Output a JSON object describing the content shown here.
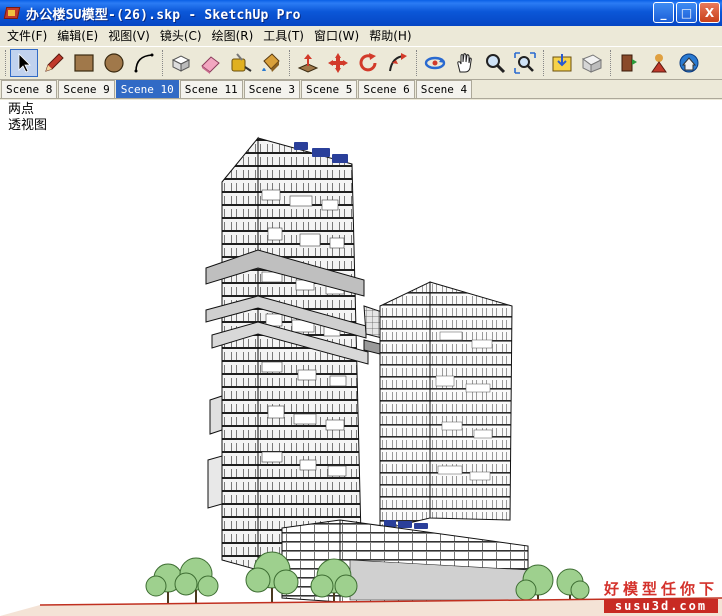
{
  "window": {
    "title": "办公楼SU模型-(26).skp - SketchUp Pro",
    "minimize_label": "_",
    "maximize_label": "□",
    "close_label": "X"
  },
  "menu": [
    {
      "id": "file",
      "label": "文件(F)"
    },
    {
      "id": "edit",
      "label": "编辑(E)"
    },
    {
      "id": "view",
      "label": "视图(V)"
    },
    {
      "id": "camera",
      "label": "镜头(C)"
    },
    {
      "id": "draw",
      "label": "绘图(R)"
    },
    {
      "id": "tools",
      "label": "工具(T)"
    },
    {
      "id": "window",
      "label": "窗口(W)"
    },
    {
      "id": "help",
      "label": "帮助(H)"
    }
  ],
  "toolbar": {
    "tools": [
      {
        "id": "select",
        "icon": "arrow-cursor-icon",
        "active": true
      },
      {
        "id": "line",
        "icon": "pencil-icon"
      },
      {
        "id": "rectangle",
        "icon": "rectangle-icon"
      },
      {
        "id": "circle",
        "icon": "circle-icon"
      },
      {
        "id": "arc",
        "icon": "arc-icon"
      },
      {
        "id": "make-component",
        "icon": "component-icon"
      },
      {
        "id": "eraser",
        "icon": "eraser-icon"
      },
      {
        "id": "tape-measure",
        "icon": "tape-measure-icon"
      },
      {
        "id": "paint-bucket",
        "icon": "paint-bucket-icon"
      },
      {
        "id": "push-pull",
        "icon": "push-pull-icon"
      },
      {
        "id": "move",
        "icon": "move-icon"
      },
      {
        "id": "rotate",
        "icon": "rotate-icon"
      },
      {
        "id": "follow-me",
        "icon": "follow-me-icon"
      },
      {
        "id": "orbit",
        "icon": "orbit-icon"
      },
      {
        "id": "pan",
        "icon": "pan-hand-icon"
      },
      {
        "id": "zoom",
        "icon": "zoom-icon"
      },
      {
        "id": "zoom-extents",
        "icon": "zoom-extents-icon"
      },
      {
        "id": "get-models",
        "icon": "get-models-icon"
      },
      {
        "id": "share-model",
        "icon": "share-model-icon"
      },
      {
        "id": "share-component",
        "icon": "share-component-icon"
      },
      {
        "id": "extension",
        "icon": "extension-icon"
      },
      {
        "id": "geo-location",
        "icon": "geo-location-icon"
      }
    ]
  },
  "scenes": [
    {
      "label": "Scene 8",
      "active": false
    },
    {
      "label": "Scene 9",
      "active": false
    },
    {
      "label": "Scene 10",
      "active": true
    },
    {
      "label": "Scene 11",
      "active": false
    },
    {
      "label": "Scene 3",
      "active": false
    },
    {
      "label": "Scene 5",
      "active": false
    },
    {
      "label": "Scene 6",
      "active": false
    },
    {
      "label": "Scene 4",
      "active": false
    }
  ],
  "viewport": {
    "label_line1": "两点",
    "label_line2": "透视图"
  },
  "watermark": {
    "main": "好模型任你下",
    "sub": "susu3d.com"
  },
  "colors": {
    "titlebar": "#0b57d8",
    "active_tab": "#316ac5",
    "watermark_red": "#d4322c",
    "building_sign": "#2a3f9a"
  }
}
